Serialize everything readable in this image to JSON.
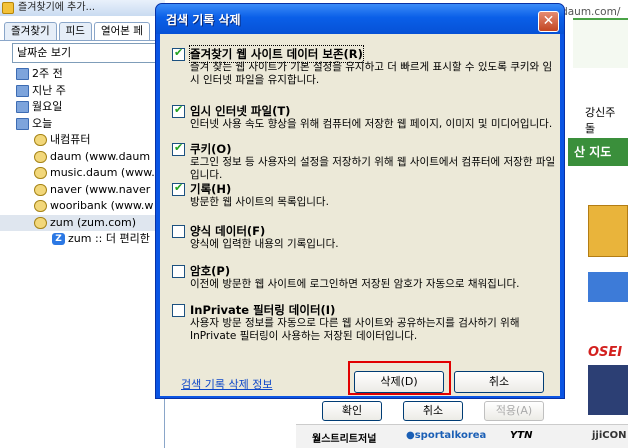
{
  "left_pane": {
    "title": "즐겨찾기에 추가...",
    "tabs": [
      "즐겨찾기",
      "피드",
      "열어본 페"
    ],
    "view_select": "날짜순 보기",
    "tree": [
      {
        "label": "2주 전",
        "type": "folder"
      },
      {
        "label": "지난 주",
        "type": "folder"
      },
      {
        "label": "월요일",
        "type": "folder"
      },
      {
        "label": "오늘",
        "type": "folder"
      },
      {
        "label": "내컴퓨터",
        "type": "site"
      },
      {
        "label": "daum (www.daum",
        "type": "site"
      },
      {
        "label": "music.daum (www.",
        "type": "site"
      },
      {
        "label": "naver (www.naver",
        "type": "site"
      },
      {
        "label": "wooribank (www.w",
        "type": "site"
      },
      {
        "label": "zum (zum.com)",
        "type": "site"
      },
      {
        "label": "zum :: 더 편리한",
        "type": "zum"
      }
    ]
  },
  "browser": {
    "url": "http://themecreator.daum.com/",
    "right_text": "강신주 돌",
    "map_button": "산 지도",
    "osen": "OSEI",
    "footer": {
      "wallstreet": "월스트리트저널",
      "sportal": "●sportalkorea",
      "ytn": "YTN",
      "jj": "jjiCON"
    }
  },
  "parent_buttons": {
    "ok": "확인",
    "cancel": "취소",
    "apply": "적용(A)"
  },
  "dialog": {
    "title": "검색 기록 삭제",
    "close_icon": "close-icon",
    "options": [
      {
        "title": "즐겨찾기 웹 사이트 데이터 보존(R)",
        "desc": "즐겨 찾는 웹 사이트가 기본 설정을 유지하고 더 빠르게 표시할 수 있도록 쿠키와 임시 인터넷 파일을 유지합니다.",
        "checked": true
      },
      {
        "title": "임시 인터넷 파일(T)",
        "desc": "인터넷 사용 속도 향상을 위해 컴퓨터에 저장한 웹 페이지, 이미지 및 미디어입니다.",
        "checked": true
      },
      {
        "title": "쿠키(O)",
        "desc": "로그인 정보 등 사용자의 설정을 저장하기 위해 웹 사이트에서 컴퓨터에 저장한 파일입니다.",
        "checked": true
      },
      {
        "title": "기록(H)",
        "desc": "방문한 웹 사이트의 목록입니다.",
        "checked": true
      },
      {
        "title": "양식 데이터(F)",
        "desc": "양식에 입력한 내용의 기록입니다.",
        "checked": false
      },
      {
        "title": "암호(P)",
        "desc": "이전에 방문한 웹 사이트에 로그인하면 저장된 암호가 자동으로 채워집니다.",
        "checked": false
      },
      {
        "title": "InPrivate 필터링 데이터(I)",
        "desc": "사용자 방문 정보를 자동으로 다른 웹 사이트와 공유하는지를 검사하기 위해 InPrivate 필터링이 사용하는 저장된 데이터입니다.",
        "checked": false
      }
    ],
    "link": "검색 기록 삭제 정보",
    "delete_button": "삭제(D)",
    "cancel_button": "취소"
  }
}
